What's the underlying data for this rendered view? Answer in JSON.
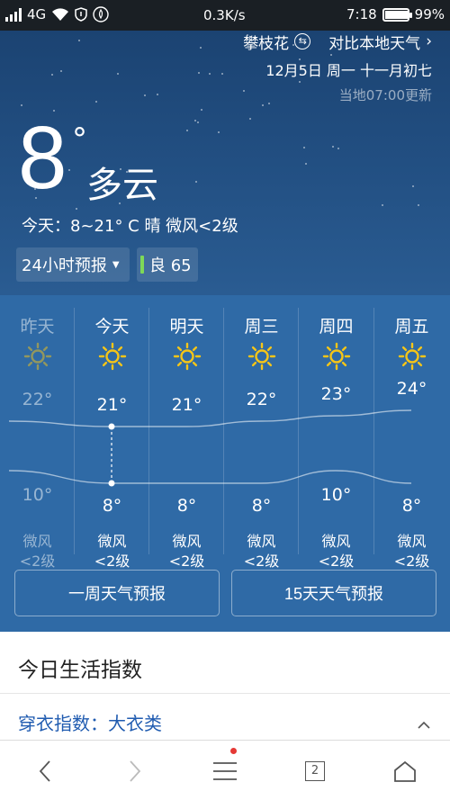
{
  "status_bar": {
    "network": "4G",
    "speed": "0.3K/s",
    "time": "7:18",
    "battery_text": "99%",
    "battery_level": 0.99
  },
  "header": {
    "city": "攀枝花",
    "compare_link": "对比本地天气",
    "date": "12月5日 周一 十一月初七",
    "updated": "当地07:00更新"
  },
  "current": {
    "temp": "8",
    "degree": "°",
    "condition": "多云",
    "today_summary": "今天：8~21° C 晴 微风<2级"
  },
  "controls": {
    "forecast_mode": "24小时预报",
    "aqi_label": "良 65",
    "aqi_color": "#7ed957"
  },
  "forecast": {
    "days": [
      {
        "name": "昨天",
        "hi": "22°",
        "lo": "10°",
        "hi_val": 22,
        "lo_val": 10,
        "wind1": "微风",
        "wind2": "<2级",
        "icon": "sun-icon",
        "past": true
      },
      {
        "name": "今天",
        "hi": "21°",
        "lo": "8°",
        "hi_val": 21,
        "lo_val": 8,
        "wind1": "微风",
        "wind2": "<2级",
        "icon": "sun-icon",
        "past": false
      },
      {
        "name": "明天",
        "hi": "21°",
        "lo": "8°",
        "hi_val": 21,
        "lo_val": 8,
        "wind1": "微风",
        "wind2": "<2级",
        "icon": "sun-icon",
        "past": false
      },
      {
        "name": "周三",
        "hi": "22°",
        "lo": "8°",
        "hi_val": 22,
        "lo_val": 8,
        "wind1": "微风",
        "wind2": "<2级",
        "icon": "sun-icon",
        "past": false
      },
      {
        "name": "周四",
        "hi": "23°",
        "lo": "10°",
        "hi_val": 23,
        "lo_val": 10,
        "wind1": "微风",
        "wind2": "<2级",
        "icon": "sun-icon",
        "past": false
      },
      {
        "name": "周五",
        "hi": "24°",
        "lo": "8°",
        "hi_val": 24,
        "lo_val": 8,
        "wind1": "微风",
        "wind2": "<2级",
        "icon": "sun-icon",
        "past": false
      }
    ],
    "week_button": "一周天气预报",
    "fifteen_button": "15天天气预报"
  },
  "life": {
    "title": "今日生活指数",
    "dress_index": "穿衣指数：大衣类"
  },
  "navbar": {
    "tab_count": "2"
  },
  "colors": {
    "sun": "#f5c518",
    "link": "#1f5bb0"
  }
}
